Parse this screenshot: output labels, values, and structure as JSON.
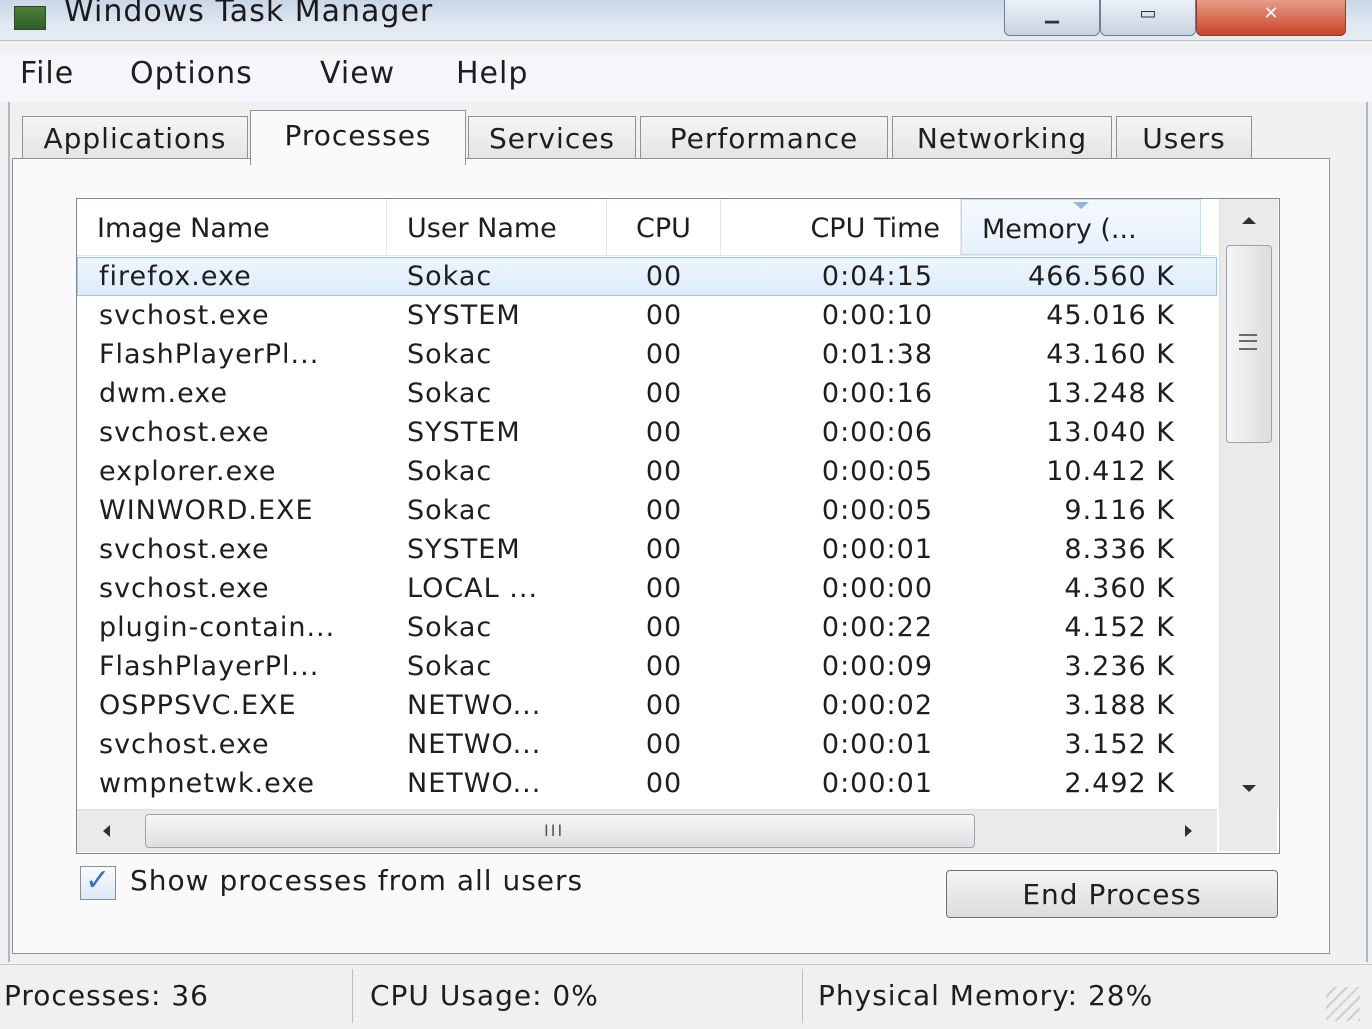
{
  "window": {
    "title": "Windows Task Manager"
  },
  "menu": [
    "File",
    "Options",
    "View",
    "Help"
  ],
  "tabs": [
    "Applications",
    "Processes",
    "Services",
    "Performance",
    "Networking",
    "Users"
  ],
  "active_tab": "Processes",
  "columns": [
    "Image Name",
    "User Name",
    "CPU",
    "CPU Time",
    "Memory (..."
  ],
  "processes": [
    {
      "image": "firefox.exe",
      "user": "Sokac",
      "cpu": "00",
      "cpu_time": "0:04:15",
      "memory": "466.560 K"
    },
    {
      "image": "svchost.exe",
      "user": "SYSTEM",
      "cpu": "00",
      "cpu_time": "0:00:10",
      "memory": "45.016 K"
    },
    {
      "image": "FlashPlayerPl...",
      "user": "Sokac",
      "cpu": "00",
      "cpu_time": "0:01:38",
      "memory": "43.160 K"
    },
    {
      "image": "dwm.exe",
      "user": "Sokac",
      "cpu": "00",
      "cpu_time": "0:00:16",
      "memory": "13.248 K"
    },
    {
      "image": "svchost.exe",
      "user": "SYSTEM",
      "cpu": "00",
      "cpu_time": "0:00:06",
      "memory": "13.040 K"
    },
    {
      "image": "explorer.exe",
      "user": "Sokac",
      "cpu": "00",
      "cpu_time": "0:00:05",
      "memory": "10.412 K"
    },
    {
      "image": "WINWORD.EXE",
      "user": "Sokac",
      "cpu": "00",
      "cpu_time": "0:00:05",
      "memory": "9.116 K"
    },
    {
      "image": "svchost.exe",
      "user": "SYSTEM",
      "cpu": "00",
      "cpu_time": "0:00:01",
      "memory": "8.336 K"
    },
    {
      "image": "svchost.exe",
      "user": "LOCAL ...",
      "cpu": "00",
      "cpu_time": "0:00:00",
      "memory": "4.360 K"
    },
    {
      "image": "plugin-contain...",
      "user": "Sokac",
      "cpu": "00",
      "cpu_time": "0:00:22",
      "memory": "4.152 K"
    },
    {
      "image": "FlashPlayerPl...",
      "user": "Sokac",
      "cpu": "00",
      "cpu_time": "0:00:09",
      "memory": "3.236 K"
    },
    {
      "image": "OSPPSVC.EXE",
      "user": "NETWO...",
      "cpu": "00",
      "cpu_time": "0:00:02",
      "memory": "3.188 K"
    },
    {
      "image": "svchost.exe",
      "user": "NETWO...",
      "cpu": "00",
      "cpu_time": "0:00:01",
      "memory": "3.152 K"
    },
    {
      "image": "wmpnetwk.exe",
      "user": "NETWO...",
      "cpu": "00",
      "cpu_time": "0:00:01",
      "memory": "2.492 K"
    }
  ],
  "selected_row": 0,
  "hscroll_grip": "III",
  "show_all_users": {
    "label": "Show processes from all users",
    "checked": true
  },
  "end_process_label": "End Process",
  "status": {
    "processes": "Processes: 36",
    "cpu_usage": "CPU Usage: 0%",
    "physical_memory": "Physical Memory: 28%"
  },
  "colors": {
    "selection": "#dcebfa",
    "sorted_header": "#e6f1fb",
    "close_button": "#c9452a"
  }
}
